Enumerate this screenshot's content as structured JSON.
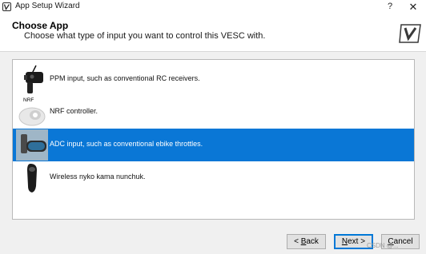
{
  "window": {
    "title": "App Setup Wizard",
    "help_glyph": "?",
    "close_glyph": "✕"
  },
  "header": {
    "title": "Choose App",
    "subtitle": "Choose what type of input you want to control this VESC with."
  },
  "list": {
    "items": [
      {
        "label": "PPM input, such as conventional RC receivers.",
        "icon": "rc-transmitter-icon",
        "selected": false
      },
      {
        "label": "NRF controller.",
        "icon": "nrf-remote-icon",
        "tag": "NRF",
        "selected": false
      },
      {
        "label": "ADC input, such as conventional ebike throttles.",
        "icon": "ebike-throttle-icon",
        "selected": true
      },
      {
        "label": "Wireless nyko kama nunchuk.",
        "icon": "nunchuk-icon",
        "selected": false
      }
    ]
  },
  "buttons": {
    "back": {
      "mnemonic": "B",
      "rest": "ack",
      "prefix": "< "
    },
    "next": {
      "mnemonic": "N",
      "rest": "ext >"
    },
    "cancel": {
      "mnemonic": "C",
      "rest": "ancel"
    }
  },
  "colors": {
    "selection": "#0a77d6",
    "default_button_border": "#0078d7"
  },
  "watermark": "CSDN @..."
}
